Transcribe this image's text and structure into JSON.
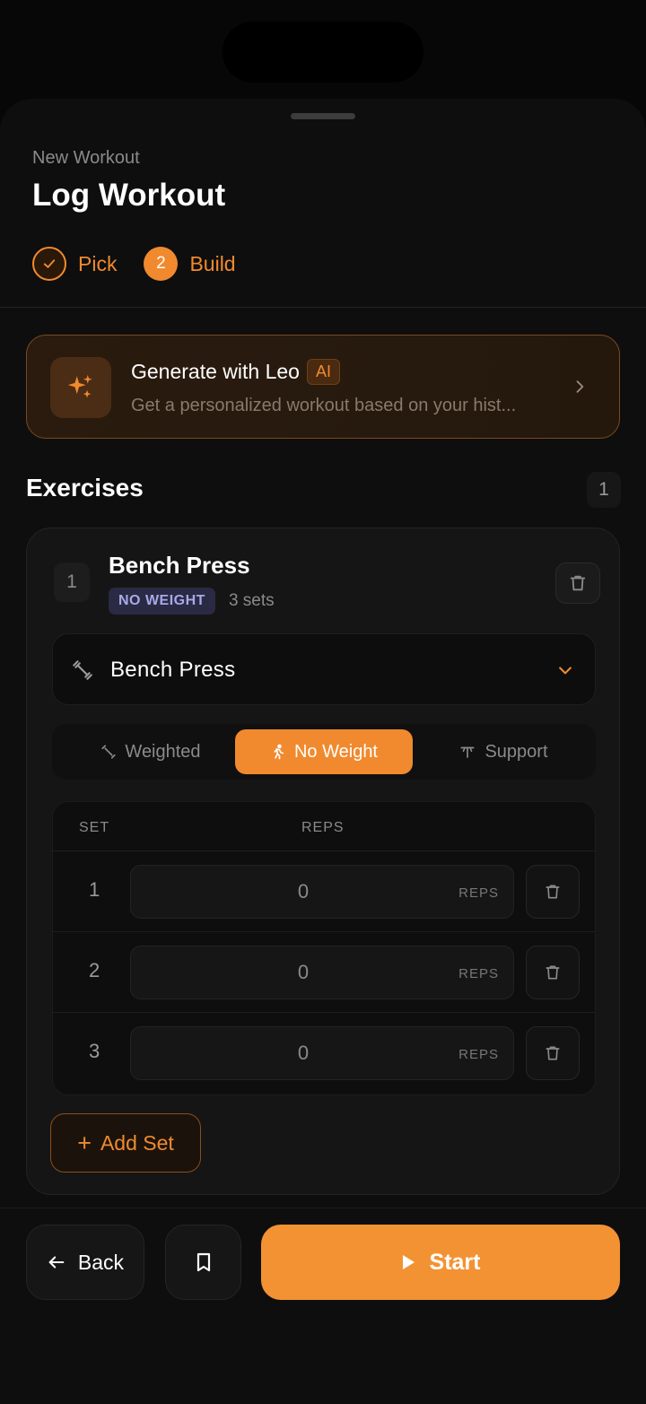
{
  "header": {
    "eyebrow": "New Workout",
    "title": "Log Workout"
  },
  "steps": [
    {
      "label": "Pick",
      "state": "done",
      "icon": "check-icon"
    },
    {
      "label": "Build",
      "state": "active",
      "number": "2"
    }
  ],
  "leo": {
    "title": "Generate with Leo",
    "badge": "AI",
    "subtitle": "Get a personalized workout based on your hist...",
    "icon": "sparkles-icon"
  },
  "exercises": {
    "title": "Exercises",
    "count": "1",
    "items": [
      {
        "index": "1",
        "name": "Bench Press",
        "type_badge": "NO WEIGHT",
        "sets_label": "3 sets",
        "selected_exercise": "Bench Press",
        "modes": [
          {
            "label": "Weighted",
            "icon": "dumbbell-icon",
            "active": false
          },
          {
            "label": "No Weight",
            "icon": "running-icon",
            "active": true
          },
          {
            "label": "Support",
            "icon": "support-icon",
            "active": false
          }
        ],
        "table": {
          "col_set": "SET",
          "col_reps": "REPS",
          "rows": [
            {
              "set": "1",
              "reps": "0",
              "unit": "REPS"
            },
            {
              "set": "2",
              "reps": "0",
              "unit": "REPS"
            },
            {
              "set": "3",
              "reps": "0",
              "unit": "REPS"
            }
          ]
        },
        "add_set_label": "Add Set"
      }
    ]
  },
  "footer": {
    "back_label": "Back",
    "start_label": "Start"
  },
  "colors": {
    "accent": "#f18a2e",
    "background": "#0e0e0e",
    "badge_text": "#a8a8e8"
  }
}
